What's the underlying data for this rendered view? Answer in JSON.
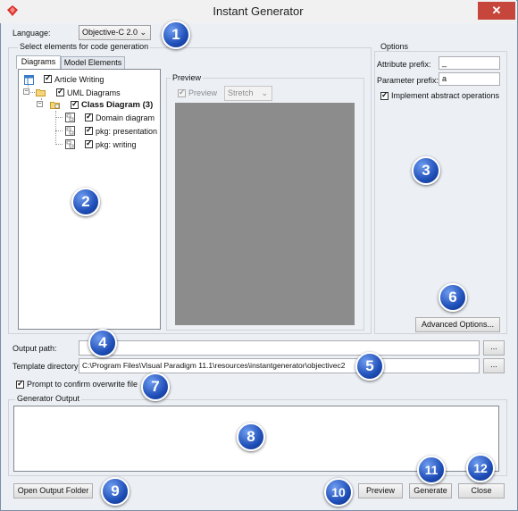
{
  "window": {
    "title": "Instant Generator"
  },
  "language": {
    "label": "Language:",
    "value": "Objective-C 2.0"
  },
  "select_group": {
    "label": "Select elements for code generation"
  },
  "tabs": [
    {
      "label": "Diagrams"
    },
    {
      "label": "Model Elements"
    }
  ],
  "tree": [
    {
      "label": "Article Writing"
    },
    {
      "label": "UML Diagrams"
    },
    {
      "label": "Class Diagram (3)"
    },
    {
      "label": "Domain diagram"
    },
    {
      "label": "pkg: presentation"
    },
    {
      "label": "pkg: writing"
    }
  ],
  "preview": {
    "group_label": "Preview",
    "checkbox_label": "Preview",
    "mode": "Stretch"
  },
  "options": {
    "group_label": "Options",
    "attribute_prefix_label": "Attribute prefix:",
    "attribute_prefix_value": "_",
    "parameter_prefix_label": "Parameter prefix:",
    "parameter_prefix_value": "a",
    "implement_abstract_label": "Implement abstract operations",
    "advanced_button": "Advanced Options..."
  },
  "output_path": {
    "label": "Output path:",
    "value": "",
    "browse": "..."
  },
  "template_dir": {
    "label": "Template directory:",
    "value": "C:\\Program Files\\Visual Paradigm 11.1\\resources\\instantgenerator\\objectivec2",
    "browse": "..."
  },
  "prompt_overwrite": {
    "label": "Prompt to confirm overwrite file"
  },
  "generator_output": {
    "label": "Generator Output"
  },
  "buttons": {
    "open_output_folder": "Open Output Folder",
    "preview": "Preview",
    "generate": "Generate",
    "close": "Close"
  },
  "badges": [
    "1",
    "2",
    "3",
    "4",
    "5",
    "6",
    "7",
    "8",
    "9",
    "10",
    "11",
    "12"
  ],
  "colors": {
    "badge": "#1f4fb8",
    "close_button": "#c7463c",
    "preview_area": "#8c8c8c"
  }
}
